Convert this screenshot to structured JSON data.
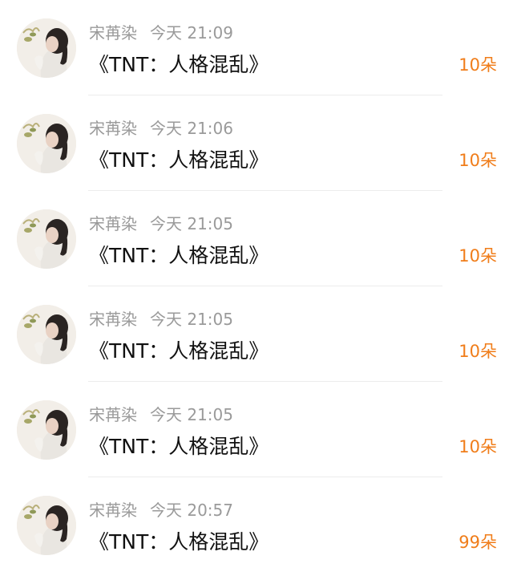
{
  "items": [
    {
      "name": "宋苒染",
      "time": "今天 21:09",
      "title": "《TNT：人格混乱》",
      "gift": "10朵"
    },
    {
      "name": "宋苒染",
      "time": "今天 21:06",
      "title": "《TNT：人格混乱》",
      "gift": "10朵"
    },
    {
      "name": "宋苒染",
      "time": "今天 21:05",
      "title": "《TNT：人格混乱》",
      "gift": "10朵"
    },
    {
      "name": "宋苒染",
      "time": "今天 21:05",
      "title": "《TNT：人格混乱》",
      "gift": "10朵"
    },
    {
      "name": "宋苒染",
      "time": "今天 21:05",
      "title": "《TNT：人格混乱》",
      "gift": "10朵"
    },
    {
      "name": "宋苒染",
      "time": "今天 20:57",
      "title": "《TNT：人格混乱》",
      "gift": "99朵"
    }
  ],
  "colors": {
    "meta_text": "#9a9a9a",
    "title_text": "#111111",
    "gift_accent": "#f07d1a",
    "divider": "#ececec"
  },
  "icons": {
    "avatar": "user-avatar-photo"
  }
}
